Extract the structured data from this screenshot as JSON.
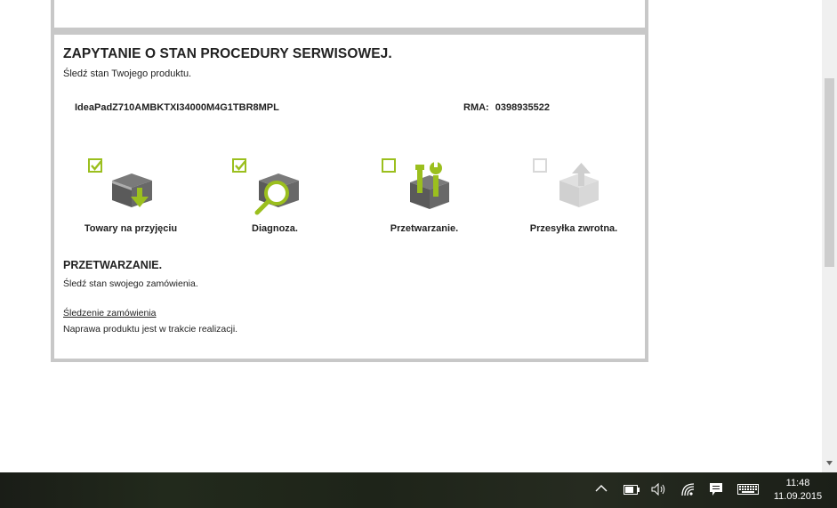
{
  "service": {
    "title": "ZAPYTANIE O STAN PROCEDURY SERWISOWEJ.",
    "subtitle": "Śledź stan Twojego produktu.",
    "product": "IdeaPadZ710AMBKTXI34000M4G1TBR8MPL",
    "rma_label": "RMA:",
    "rma_value": "0398935522"
  },
  "steps": [
    {
      "label": "Towary na przyjęciu",
      "checked": true,
      "icon": "box-download-icon"
    },
    {
      "label": "Diagnoza.",
      "checked": true,
      "icon": "box-magnifier-icon"
    },
    {
      "label": "Przetwarzanie.",
      "checked": false,
      "icon": "box-tools-icon"
    },
    {
      "label": "Przesyłka zwrotna.",
      "checked": false,
      "disabled": true,
      "icon": "box-upload-icon"
    }
  ],
  "section": {
    "title": "PRZETWARZANIE.",
    "subtitle": "Śledź stan swojego zamówienia.",
    "link": "Śledzenie zamówienia",
    "status": "Naprawa produktu jest w trakcie realizacji."
  },
  "colors": {
    "accent": "#9bbf1e",
    "icon_dark": "#5a5a5a",
    "icon_disabled": "#d8d8d8"
  },
  "taskbar": {
    "time": "11:48",
    "date": "11.09.2015"
  }
}
